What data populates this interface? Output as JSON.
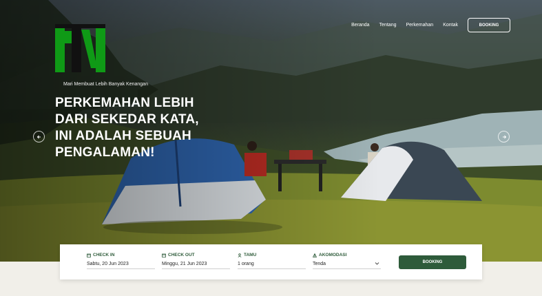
{
  "brand": {
    "tagline": "Mari Membuat Lebih Banyak Kenangan",
    "logo_colors": [
      "#0f9a16",
      "#111111"
    ]
  },
  "nav": {
    "links": [
      "Beranda",
      "Tentang",
      "Perkemahan",
      "Kontak"
    ],
    "cta_label": "BOOKING"
  },
  "hero": {
    "headline_lines": [
      "PERKEMAHAN LEBIH",
      "DARI SEKEDAR KATA,",
      "INI ADALAH SEBUAH",
      "PENGALAMAN!"
    ],
    "prev_icon": "arrow-left-icon",
    "next_icon": "arrow-right-icon"
  },
  "booking_form": {
    "fields": [
      {
        "label": "CHECK IN",
        "value": "Sabtu, 20 Jun 2023",
        "icon": "calendar-icon"
      },
      {
        "label": "CHECK OUT",
        "value": "Minggu, 21 Jun 2023",
        "icon": "calendar-icon"
      },
      {
        "label": "TAMU",
        "value": "1 orang",
        "icon": "user-icon"
      },
      {
        "label": "AKOMODASI",
        "value": "Tenda",
        "icon": "tent-icon"
      }
    ],
    "submit_label": "BOOKING"
  },
  "colors": {
    "brand_green": "#2e5b3a",
    "logo_green": "#0f9a16"
  }
}
